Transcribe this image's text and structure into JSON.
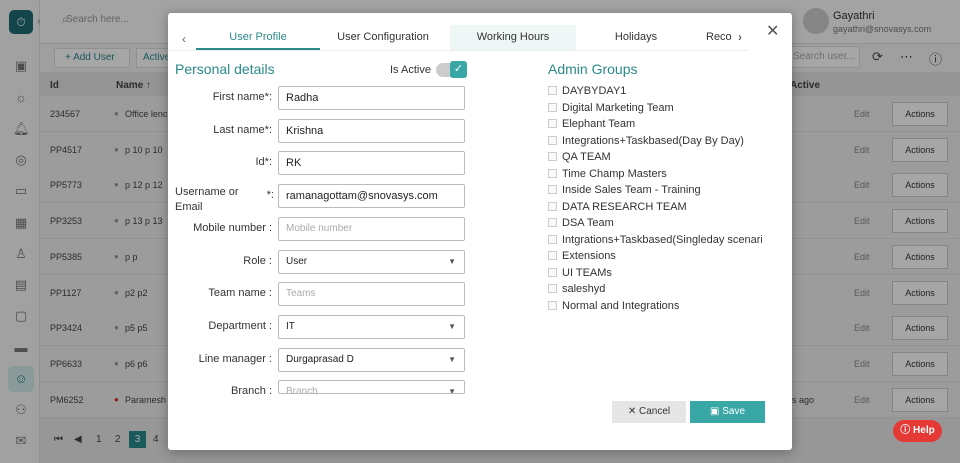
{
  "app": {
    "search_placeholder": "Search here...",
    "user_name": "Gayathri",
    "user_email": "gayathri@snovasys.com",
    "add_user": "Add User",
    "active_btn": "Active",
    "search_user_placeholder": "Search user...",
    "columns": {
      "id": "Id",
      "name": "Name",
      "active": "Active"
    },
    "rows": [
      {
        "id": "234567",
        "name": "Office lenovo",
        "active": "",
        "edit": "Edit",
        "actions": "Actions"
      },
      {
        "id": "PP4517",
        "name": "p 10 p 10",
        "active": "",
        "edit": "Edit",
        "actions": "Actions"
      },
      {
        "id": "PP5773",
        "name": "p 12 p 12",
        "active": "",
        "edit": "Edit",
        "actions": "Actions"
      },
      {
        "id": "PP3253",
        "name": "p 13 p 13",
        "active": "",
        "edit": "Edit",
        "actions": "Actions"
      },
      {
        "id": "PP5385",
        "name": "p p",
        "active": "",
        "edit": "Edit",
        "actions": "Actions"
      },
      {
        "id": "PP1127",
        "name": "p2 p2",
        "active": "",
        "edit": "Edit",
        "actions": "Actions"
      },
      {
        "id": "PP3424",
        "name": "p5 p5",
        "active": "",
        "edit": "Edit",
        "actions": "Actions"
      },
      {
        "id": "PP6633",
        "name": "p6 p6",
        "active": "",
        "edit": "Edit",
        "actions": "Actions"
      },
      {
        "id": "PM6252",
        "name": "Paramesh",
        "active": "s ago",
        "edit": "Edit",
        "actions": "Actions"
      }
    ],
    "pagination": [
      "1",
      "2",
      "3",
      "4"
    ],
    "current_page": "3",
    "help": "Help"
  },
  "modal": {
    "tabs": [
      "User Profile",
      "User Configuration",
      "Working Hours",
      "Holidays",
      "Reco"
    ],
    "active_tab": 0,
    "personal_title": "Personal details",
    "is_active_label": "Is Active",
    "is_active": true,
    "fields": [
      {
        "label": "First name*:",
        "value": "Radha",
        "placeholder": "",
        "type": "text"
      },
      {
        "label": "Last name*:",
        "value": "Krishna",
        "placeholder": "",
        "type": "text"
      },
      {
        "label": "Id*:",
        "value": "RK",
        "placeholder": "",
        "type": "text"
      },
      {
        "label": "*:",
        "value": "ramanagottam@snovasys.com",
        "placeholder": "",
        "type": "text"
      },
      {
        "label": "Mobile number :",
        "value": "",
        "placeholder": "Mobile number",
        "type": "text"
      },
      {
        "label": "Role :",
        "value": "User",
        "placeholder": "",
        "type": "select"
      },
      {
        "label": "Team name :",
        "value": "",
        "placeholder": "Teams",
        "type": "text"
      },
      {
        "label": "Department :",
        "value": "IT",
        "placeholder": "",
        "type": "select"
      },
      {
        "label": "Line manager :",
        "value": "Durgaprasad D",
        "placeholder": "",
        "type": "select"
      },
      {
        "label": "Branch :",
        "value": "",
        "placeholder": "Branch",
        "type": "select"
      }
    ],
    "username_label_line1": "Username or",
    "username_label_line2": "Email",
    "admin_title": "Admin Groups",
    "admin_groups": [
      "DAYBYDAY1",
      "Digital Marketing Team",
      "Elephant Team",
      "Integrations+Taskbased(Day By Day)",
      "QA TEAM",
      "Time Champ Masters",
      "Inside Sales Team - Training",
      "DATA RESEARCH TEAM",
      "DSA Team",
      "Intgrations+Taskbased(Singleday scenario)",
      "Extensions",
      "UI TEAMs",
      "saleshyd",
      "Normal and Integrations"
    ],
    "cancel": "Cancel",
    "save": "Save"
  }
}
